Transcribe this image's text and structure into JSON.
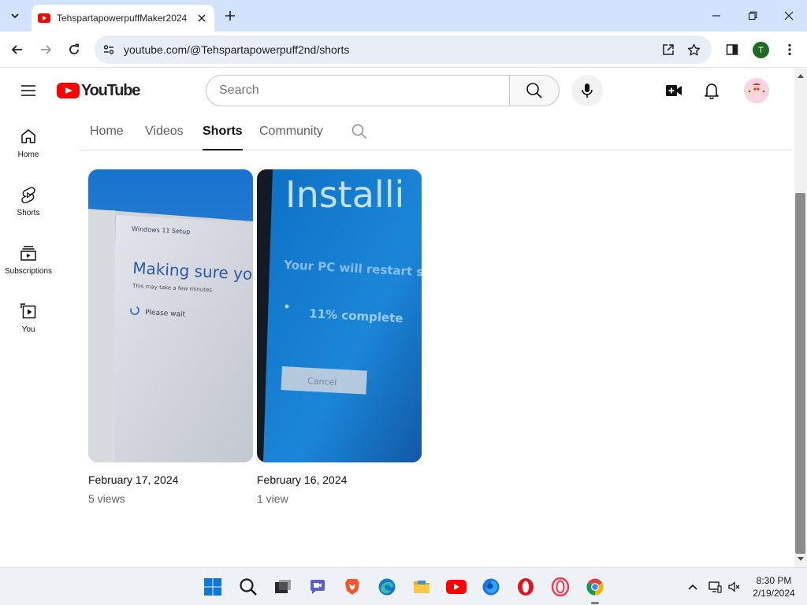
{
  "browser": {
    "tab_title": "TehspartapowerpuffMaker2024",
    "url": "youtube.com/@Tehspartapowerpuff2nd/shorts",
    "profile_initial": "T"
  },
  "youtube": {
    "logo_text": "YouTube",
    "search_placeholder": "Search",
    "guide": [
      {
        "label": "Home"
      },
      {
        "label": "Shorts"
      },
      {
        "label": "Subscriptions"
      },
      {
        "label": "You"
      }
    ],
    "channel_tabs": [
      {
        "label": "Home"
      },
      {
        "label": "Videos"
      },
      {
        "label": "Shorts",
        "active": true
      },
      {
        "label": "Community"
      }
    ],
    "shorts": [
      {
        "date": "February 17, 2024",
        "views": "5 views",
        "thumb_text": [
          "Windows 11 Setup",
          "Making sure you",
          "This may take a few minutes.",
          "Please wait"
        ]
      },
      {
        "date": "February 16, 2024",
        "views": "1 view",
        "thumb_text": [
          "Installi",
          "Your PC will restart sev",
          "11% complete",
          "Cancel"
        ]
      }
    ]
  },
  "taskbar": {
    "time": "8:30 PM",
    "date": "2/19/2024"
  },
  "colors": {
    "yt_red": "#ff0000",
    "tabstrip": "#d3e3fd",
    "omnibox": "#e9eef6"
  }
}
